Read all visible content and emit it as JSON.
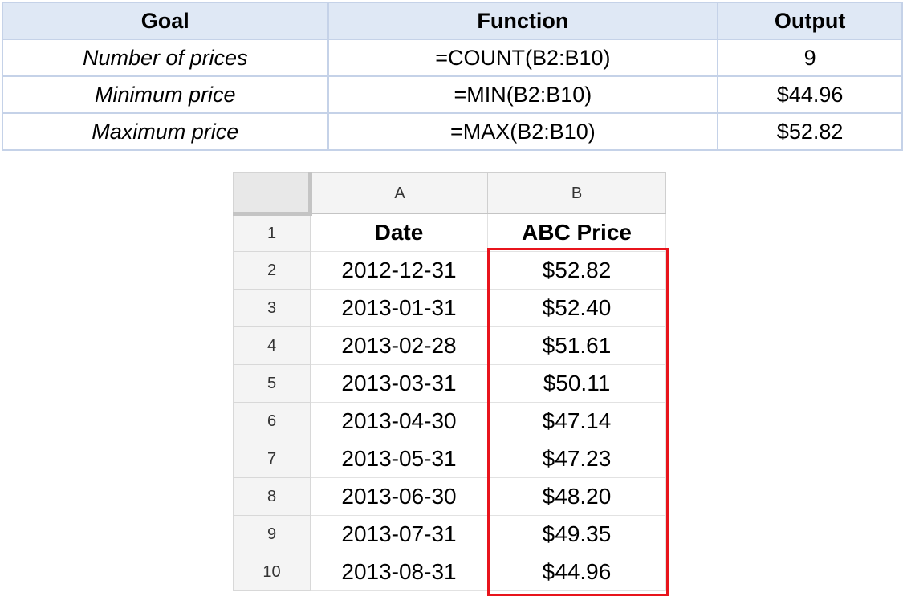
{
  "summary": {
    "headers": [
      "Goal",
      "Function",
      "Output"
    ],
    "rows": [
      {
        "goal": "Number of prices",
        "function": "=COUNT(B2:B10)",
        "output": "9"
      },
      {
        "goal": "Minimum price",
        "function": "=MIN(B2:B10)",
        "output": "$44.96"
      },
      {
        "goal": "Maximum price",
        "function": "=MAX(B2:B10)",
        "output": "$52.82"
      }
    ]
  },
  "sheet": {
    "columns": [
      "A",
      "B"
    ],
    "row_numbers": [
      "1",
      "2",
      "3",
      "4",
      "5",
      "6",
      "7",
      "8",
      "9",
      "10"
    ],
    "header_row": {
      "date": "Date",
      "price": "ABC Price"
    },
    "rows": [
      {
        "date": "2012-12-31",
        "price": "$52.82"
      },
      {
        "date": "2013-01-31",
        "price": "$52.40"
      },
      {
        "date": "2013-02-28",
        "price": "$51.61"
      },
      {
        "date": "2013-03-31",
        "price": "$50.11"
      },
      {
        "date": "2013-04-30",
        "price": "$47.14"
      },
      {
        "date": "2013-05-31",
        "price": "$47.23"
      },
      {
        "date": "2013-06-30",
        "price": "$48.20"
      },
      {
        "date": "2013-07-31",
        "price": "$49.35"
      },
      {
        "date": "2013-08-31",
        "price": "$44.96"
      }
    ],
    "highlight_color": "#e8141c"
  }
}
